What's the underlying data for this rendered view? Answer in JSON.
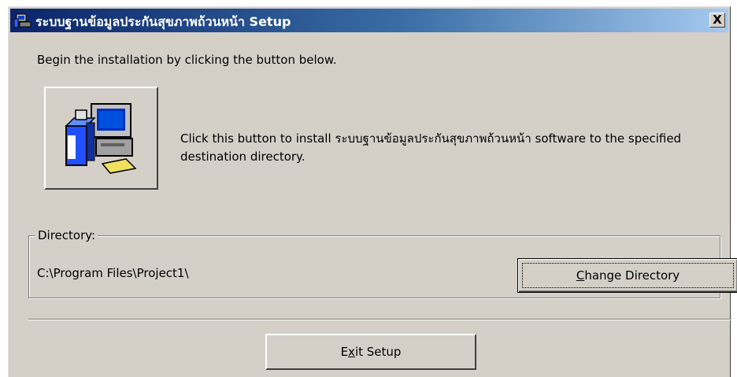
{
  "window": {
    "title": "ระบบฐานข้อมูลประกันสุขภาพถ้วนหน้า Setup",
    "close_label": "X"
  },
  "intro_text": "Begin the installation by clicking the button below.",
  "install": {
    "icon": "computer-setup-icon",
    "description": "Click this button to install ระบบฐานข้อมูลประกันสุขภาพถ้วนหน้า software to the specified destination directory."
  },
  "directory": {
    "legend": "Directory:",
    "path": "C:\\Program Files\\Project1\\",
    "change_label_prefix": "C",
    "change_label_rest": "hange Directory"
  },
  "exit": {
    "label_prefix": "E",
    "label_mnemonic": "x",
    "label_rest": "it Setup"
  },
  "colors": {
    "face": "#d4d0c8",
    "title_start": "#0a246a",
    "title_end": "#a6caf0"
  }
}
